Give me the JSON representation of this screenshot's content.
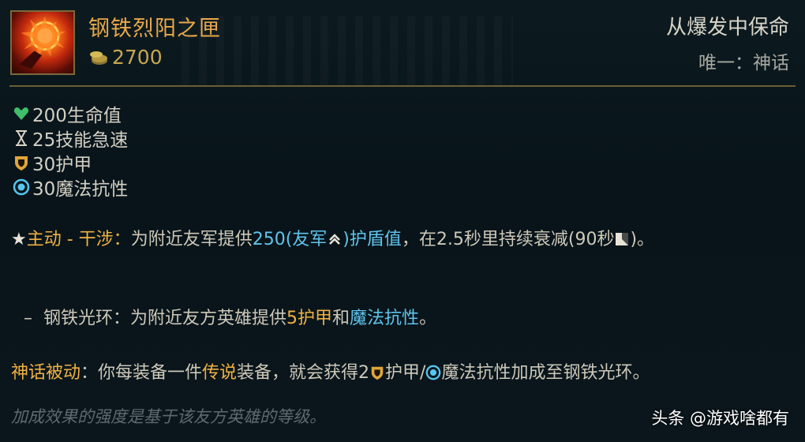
{
  "item": {
    "name": "钢铁烈阳之匣",
    "cost": "2700",
    "tagline": "从爆发中保命",
    "rarity": "唯一：神话"
  },
  "stats": [
    {
      "icon": "heart-icon",
      "text": "200生命值"
    },
    {
      "icon": "hourglass-icon",
      "text": "25技能急速"
    },
    {
      "icon": "shield-icon",
      "text": "30护甲"
    },
    {
      "icon": "magic-resist-icon",
      "text": "30魔法抗性"
    }
  ],
  "active": {
    "label": "主动 - 干涉",
    "colon": "：",
    "pre": "为附近友军提供",
    "value": "250(友军",
    "value_end": ")护盾值",
    "post": "，在2.5秒里持续衰减(90秒",
    "end": ")。"
  },
  "aura": {
    "dash": "–",
    "label": "钢铁光环",
    "pre": "：为附近友方英雄提供",
    "armor": "5护甲",
    "and": "和",
    "mr": "魔法抗性",
    "end": "。"
  },
  "mythic": {
    "label": "神话被动",
    "pre": "：你每装备一件",
    "legendary": "传说",
    "mid": "装备，就会获得2",
    "armor_slash": "护甲/",
    "post": "魔法抗性加成至钢铁光环。"
  },
  "footnote": "加成效果的强度是基于该友方英雄的等级。",
  "watermark": "头条 @游戏啥都有",
  "colors": {
    "gold": "#f0b142",
    "blue": "#5fc4ec",
    "heart": "#3fbf6a"
  }
}
